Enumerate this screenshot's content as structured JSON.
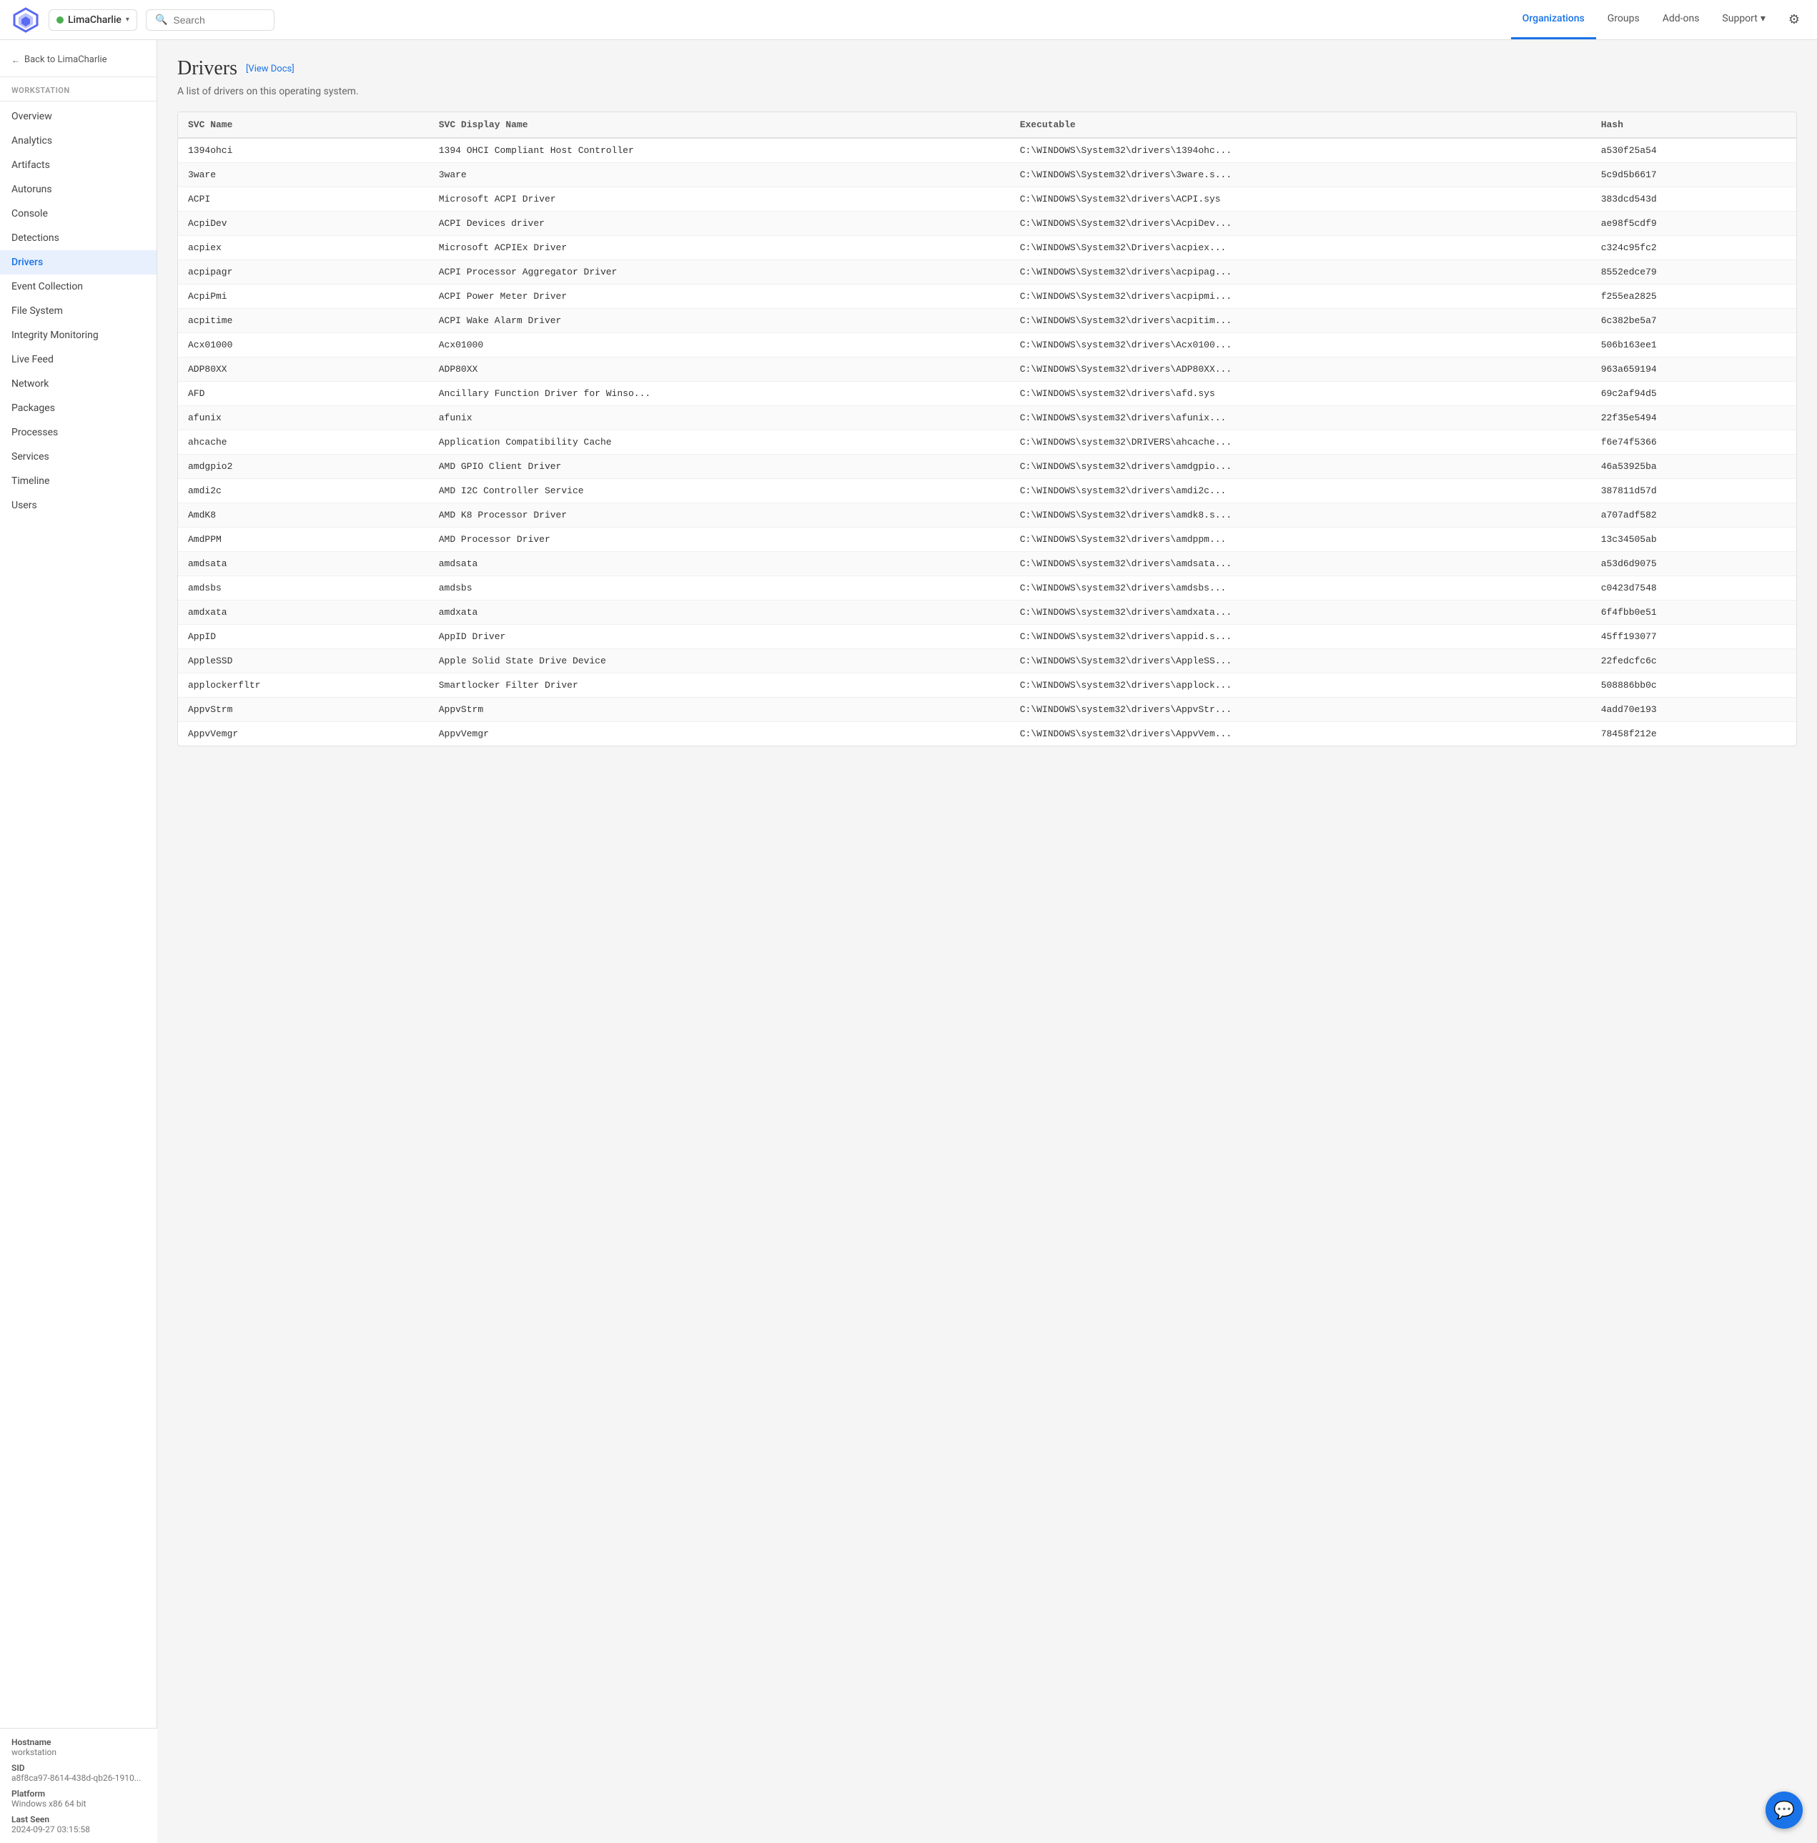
{
  "topnav": {
    "org_name": "LimaCharlie",
    "search_placeholder": "Search",
    "nav_items": [
      {
        "label": "Organizations",
        "active": true
      },
      {
        "label": "Groups",
        "active": false
      },
      {
        "label": "Add-ons",
        "active": false
      },
      {
        "label": "Support",
        "active": false,
        "has_dropdown": true
      }
    ]
  },
  "sidebar": {
    "back_label": "Back to LimaCharlie",
    "section_label": "WORKSTATION",
    "items": [
      {
        "label": "Overview",
        "active": false
      },
      {
        "label": "Analytics",
        "active": false
      },
      {
        "label": "Artifacts",
        "active": false
      },
      {
        "label": "Autoruns",
        "active": false
      },
      {
        "label": "Console",
        "active": false
      },
      {
        "label": "Detections",
        "active": false
      },
      {
        "label": "Drivers",
        "active": true
      },
      {
        "label": "Event Collection",
        "active": false
      },
      {
        "label": "File System",
        "active": false
      },
      {
        "label": "Integrity Monitoring",
        "active": false
      },
      {
        "label": "Live Feed",
        "active": false
      },
      {
        "label": "Network",
        "active": false
      },
      {
        "label": "Packages",
        "active": false
      },
      {
        "label": "Processes",
        "active": false
      },
      {
        "label": "Services",
        "active": false
      },
      {
        "label": "Timeline",
        "active": false
      },
      {
        "label": "Users",
        "active": false
      }
    ],
    "footer": {
      "hostname_label": "Hostname",
      "hostname_value": "workstation",
      "sid_label": "SID",
      "sid_value": "a8f8ca97-8614-438d-qb26-1910...",
      "platform_label": "Platform",
      "platform_value": "Windows x86 64 bit",
      "last_seen_label": "Last Seen",
      "last_seen_value": "2024-09-27 03:15:58"
    }
  },
  "page": {
    "title": "Drivers",
    "view_docs_label": "[View Docs]",
    "subtitle": "A list of drivers on this operating system.",
    "table": {
      "columns": [
        "SVC Name",
        "SVC Display Name",
        "Executable",
        "Hash"
      ],
      "rows": [
        {
          "svc_name": "1394ohci",
          "display_name": "1394 OHCI Compliant Host Controller",
          "executable": "C:\\WINDOWS\\System32\\drivers\\1394ohc...",
          "hash": "a530f25a54"
        },
        {
          "svc_name": "3ware",
          "display_name": "3ware",
          "executable": "C:\\WINDOWS\\System32\\drivers\\3ware.s...",
          "hash": "5c9d5b6617"
        },
        {
          "svc_name": "ACPI",
          "display_name": "Microsoft ACPI Driver",
          "executable": "C:\\WINDOWS\\System32\\drivers\\ACPI.sys",
          "hash": "383dcd543d"
        },
        {
          "svc_name": "AcpiDev",
          "display_name": "ACPI Devices driver",
          "executable": "C:\\WINDOWS\\System32\\drivers\\AcpiDev...",
          "hash": "ae98f5cdf9"
        },
        {
          "svc_name": "acpiex",
          "display_name": "Microsoft ACPIEx Driver",
          "executable": "C:\\WINDOWS\\System32\\Drivers\\acpiex...",
          "hash": "c324c95fc2"
        },
        {
          "svc_name": "acpipagr",
          "display_name": "ACPI Processor Aggregator Driver",
          "executable": "C:\\WINDOWS\\System32\\drivers\\acpipag...",
          "hash": "8552edce79"
        },
        {
          "svc_name": "AcpiPmi",
          "display_name": "ACPI Power Meter Driver",
          "executable": "C:\\WINDOWS\\System32\\drivers\\acpipmi...",
          "hash": "f255ea2825"
        },
        {
          "svc_name": "acpitime",
          "display_name": "ACPI Wake Alarm Driver",
          "executable": "C:\\WINDOWS\\System32\\drivers\\acpitim...",
          "hash": "6c382be5a7"
        },
        {
          "svc_name": "Acx01000",
          "display_name": "Acx01000",
          "executable": "C:\\WINDOWS\\system32\\drivers\\Acx0100...",
          "hash": "506b163ee1"
        },
        {
          "svc_name": "ADP80XX",
          "display_name": "ADP80XX",
          "executable": "C:\\WINDOWS\\System32\\drivers\\ADP80XX...",
          "hash": "963a659194"
        },
        {
          "svc_name": "AFD",
          "display_name": "Ancillary Function Driver for Winso...",
          "executable": "C:\\WINDOWS\\system32\\drivers\\afd.sys",
          "hash": "69c2af94d5"
        },
        {
          "svc_name": "afunix",
          "display_name": "afunix",
          "executable": "C:\\WINDOWS\\system32\\drivers\\afunix...",
          "hash": "22f35e5494"
        },
        {
          "svc_name": "ahcache",
          "display_name": "Application Compatibility Cache",
          "executable": "C:\\WINDOWS\\system32\\DRIVERS\\ahcache...",
          "hash": "f6e74f5366"
        },
        {
          "svc_name": "amdgpio2",
          "display_name": "AMD GPIO Client Driver",
          "executable": "C:\\WINDOWS\\system32\\drivers\\amdgpio...",
          "hash": "46a53925ba"
        },
        {
          "svc_name": "amdi2c",
          "display_name": "AMD I2C Controller Service",
          "executable": "C:\\WINDOWS\\system32\\drivers\\amdi2c...",
          "hash": "387811d57d"
        },
        {
          "svc_name": "AmdK8",
          "display_name": "AMD K8 Processor Driver",
          "executable": "C:\\WINDOWS\\System32\\drivers\\amdk8.s...",
          "hash": "a707adf582"
        },
        {
          "svc_name": "AmdPPM",
          "display_name": "AMD Processor Driver",
          "executable": "C:\\WINDOWS\\System32\\drivers\\amdppm...",
          "hash": "13c34505ab"
        },
        {
          "svc_name": "amdsata",
          "display_name": "amdsata",
          "executable": "C:\\WINDOWS\\system32\\drivers\\amdsata...",
          "hash": "a53d6d9075"
        },
        {
          "svc_name": "amdsbs",
          "display_name": "amdsbs",
          "executable": "C:\\WINDOWS\\system32\\drivers\\amdsbs...",
          "hash": "c0423d7548"
        },
        {
          "svc_name": "amdxata",
          "display_name": "amdxata",
          "executable": "C:\\WINDOWS\\system32\\drivers\\amdxata...",
          "hash": "6f4fbb0e51"
        },
        {
          "svc_name": "AppID",
          "display_name": "AppID Driver",
          "executable": "C:\\WINDOWS\\system32\\drivers\\appid.s...",
          "hash": "45ff193077"
        },
        {
          "svc_name": "AppleSSD",
          "display_name": "Apple Solid State Drive Device",
          "executable": "C:\\WINDOWS\\System32\\drivers\\AppleSS...",
          "hash": "22fedcfc6c"
        },
        {
          "svc_name": "applockerfltr",
          "display_name": "Smartlocker Filter Driver",
          "executable": "C:\\WINDOWS\\system32\\drivers\\applock...",
          "hash": "508886bb0c"
        },
        {
          "svc_name": "AppvStrm",
          "display_name": "AppvStrm",
          "executable": "C:\\WINDOWS\\system32\\drivers\\AppvStr...",
          "hash": "4add70e193"
        },
        {
          "svc_name": "AppvVemgr",
          "display_name": "AppvVemgr",
          "executable": "C:\\WINDOWS\\system32\\drivers\\AppvVem...",
          "hash": "78458f212e"
        }
      ]
    }
  },
  "icons": {
    "back_arrow": "←",
    "chevron_down": "▾",
    "search": "🔍",
    "settings": "⚙",
    "chat": "💬"
  }
}
